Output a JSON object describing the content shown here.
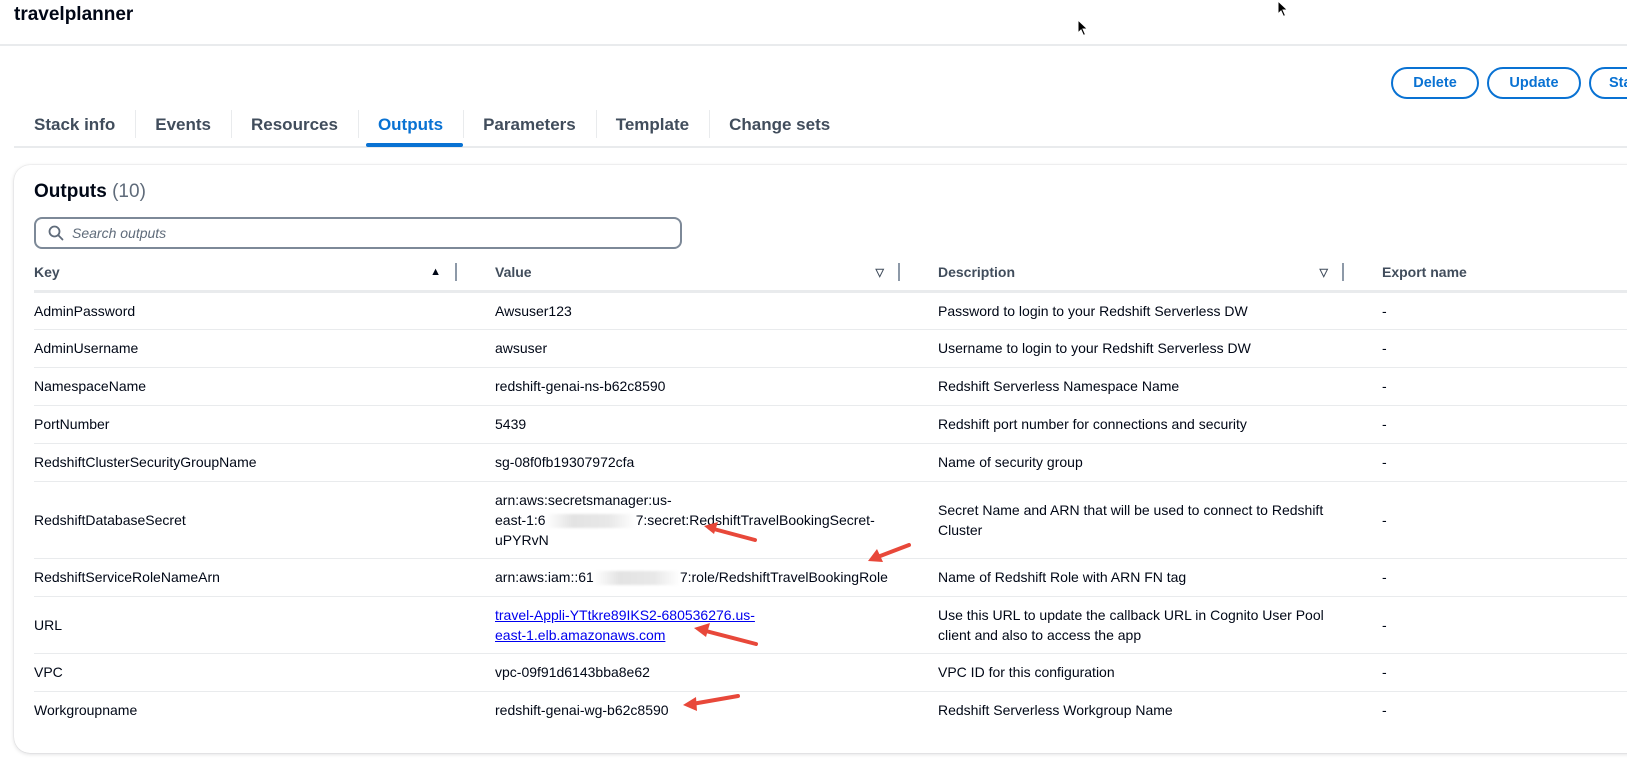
{
  "header": {
    "stack_name": "travelplanner"
  },
  "actions": {
    "delete_label": "Delete",
    "update_label": "Update",
    "stack_actions_label": "Stack actions"
  },
  "tabs": [
    {
      "label": "Stack info",
      "active": false
    },
    {
      "label": "Events",
      "active": false
    },
    {
      "label": "Resources",
      "active": false
    },
    {
      "label": "Outputs",
      "active": true
    },
    {
      "label": "Parameters",
      "active": false
    },
    {
      "label": "Template",
      "active": false
    },
    {
      "label": "Change sets",
      "active": false
    }
  ],
  "outputs": {
    "title": "Outputs",
    "count": "(10)",
    "search_placeholder": "Search outputs",
    "columns": {
      "key": "Key",
      "value": "Value",
      "description": "Description",
      "export_name": "Export name"
    },
    "sort": {
      "key": "ascending",
      "value": "none",
      "description": "none"
    },
    "rows": [
      {
        "key": "AdminPassword",
        "value": "Awsuser123",
        "description": "Password to login to your Redshift Serverless DW",
        "export": "-"
      },
      {
        "key": "AdminUsername",
        "value": "awsuser",
        "description": "Username to login to your Redshift Serverless DW",
        "export": "-"
      },
      {
        "key": "NamespaceName",
        "value": "redshift-genai-ns-b62c8590",
        "description": "Redshift Serverless Namespace Name",
        "export": "-"
      },
      {
        "key": "PortNumber",
        "value": "5439",
        "description": "Redshift port number for connections and security",
        "export": "-"
      },
      {
        "key": "RedshiftClusterSecurityGroupName",
        "value": "sg-08f0fb19307972cfa",
        "description": "Name of security group",
        "export": "-"
      },
      {
        "key": "RedshiftDatabaseSecret",
        "value_line1": "arn:aws:secretsmanager:us-",
        "value_line2a": "east-1:6",
        "value_line2b": "7:secret:RedshiftTravelBookingSecret-",
        "value_line3": "uPYRvN",
        "description": "Secret Name and ARN that will be used to connect to Redshift Cluster",
        "export": "-"
      },
      {
        "key": "RedshiftServiceRoleNameArn",
        "value_a": "arn:aws:iam::61",
        "value_b": "7:role/RedshiftTravelBookingRole",
        "description": "Name of Redshift Role with ARN FN tag",
        "export": "-"
      },
      {
        "key": "URL",
        "value_line1": "travel-Appli-YTtkre89IKS2-680536276.us-",
        "value_line2": "east-1.elb.amazonaws.com",
        "description": "Use this URL to update the callback URL in Cognito User Pool client and also to access the app",
        "export": "-"
      },
      {
        "key": "VPC",
        "value": "vpc-09f91d6143bba8e62",
        "description": "VPC ID for this configuration",
        "export": "-"
      },
      {
        "key": "Workgroupname",
        "value": "redshift-genai-wg-b62c8590",
        "description": "Redshift Serverless Workgroup Name",
        "export": "-"
      }
    ]
  },
  "colors": {
    "accent": "#0972d3",
    "annotation_arrow": "#e8483a",
    "link": "#0000ee"
  }
}
